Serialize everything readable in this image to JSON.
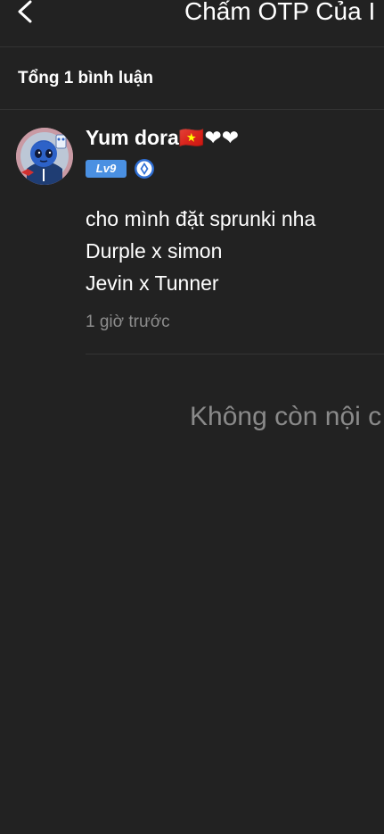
{
  "header": {
    "title": "Chấm OTP Của I",
    "back_icon": "chevron-left-icon"
  },
  "comments_summary": {
    "label": "Tổng 1 bình luận"
  },
  "comments": [
    {
      "user_name": "Yum dora",
      "name_emojis": "🇻🇳❤❤",
      "level": "Lv9",
      "badge_icon": "verified-badge-icon",
      "lines": [
        "cho mình đặt sprunki nha",
        "Durple x simon",
        "Jevin x Tunner"
      ],
      "time": "1 giờ trước"
    }
  ],
  "footer": {
    "end_message": "Không còn nội c"
  },
  "colors": {
    "background": "#222222",
    "divider": "#343434",
    "level_badge": "#4a90e2",
    "muted_text": "#8d8d8d"
  }
}
